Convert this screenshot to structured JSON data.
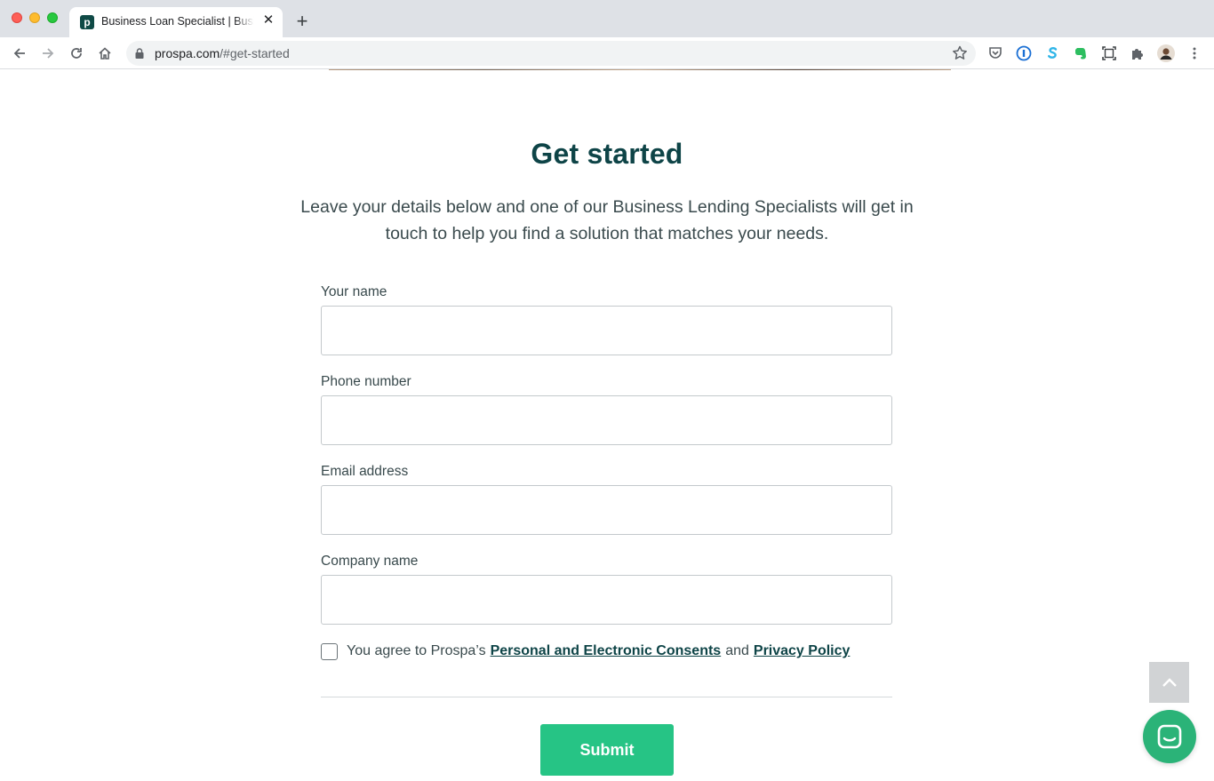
{
  "browser": {
    "tab_title": "Business Loan Specialist | Business Loan Specialist",
    "tab_favicon_letter": "p",
    "url_host": "prospa.com",
    "url_path": "/#get-started"
  },
  "colors": {
    "brand_dark": "#0e4447",
    "submit_green": "#26c485",
    "chat_green": "#2bb378"
  },
  "page": {
    "heading": "Get started",
    "intro": "Leave your details below and one of our Business Lending Specialists will get in touch to help you find a solution that matches your needs."
  },
  "form": {
    "fields": [
      {
        "label": "Your name",
        "value": ""
      },
      {
        "label": "Phone number",
        "value": ""
      },
      {
        "label": "Email address",
        "value": ""
      },
      {
        "label": "Company name",
        "value": ""
      }
    ],
    "consent": {
      "checked": false,
      "prefix": "You agree to Prospa’s",
      "link1": "Personal and Electronic Consents",
      "middle": "and",
      "link2": "Privacy Policy"
    },
    "submit_label": "Submit"
  },
  "icons": {
    "back": "arrow-left-icon",
    "forward": "arrow-right-icon",
    "reload": "reload-icon",
    "home": "home-icon",
    "bookmark": "star-icon",
    "scroll_top": "chevron-up-icon",
    "chat": "chat-icon"
  }
}
